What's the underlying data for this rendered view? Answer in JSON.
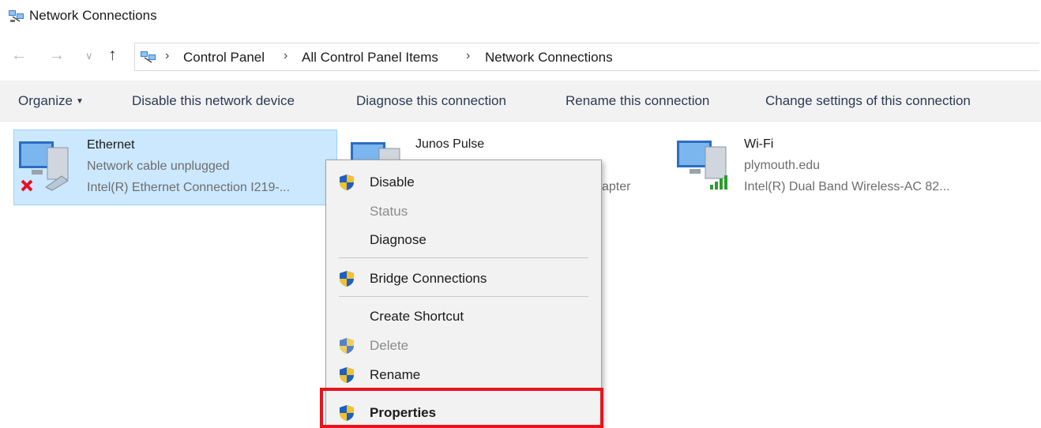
{
  "window": {
    "title": "Network Connections"
  },
  "address_bar": {
    "breadcrumbs": [
      "Control Panel",
      "All Control Panel Items",
      "Network Connections"
    ]
  },
  "command_bar": {
    "organize": "Organize",
    "disable": "Disable this network device",
    "diagnose": "Diagnose this connection",
    "rename": "Rename this connection",
    "change": "Change settings of this connection"
  },
  "adapters": [
    {
      "name": "Ethernet",
      "status": "Network cable unplugged",
      "device": "Intel(R) Ethernet Connection I219-...",
      "selected": true
    },
    {
      "name": "Junos Pulse",
      "status": "",
      "device": "apter",
      "selected": false
    },
    {
      "name": "Wi-Fi",
      "status": "plymouth.edu",
      "device": "Intel(R) Dual Band Wireless-AC 82...",
      "selected": false
    }
  ],
  "context_menu": {
    "items": [
      {
        "label": "Disable",
        "shield": true,
        "enabled": true
      },
      {
        "label": "Status",
        "shield": false,
        "enabled": false
      },
      {
        "label": "Diagnose",
        "shield": false,
        "enabled": true
      },
      {
        "label": "Bridge Connections",
        "shield": true,
        "enabled": true
      },
      {
        "label": "Create Shortcut",
        "shield": false,
        "enabled": true
      },
      {
        "label": "Delete",
        "shield": true,
        "enabled": false
      },
      {
        "label": "Rename",
        "shield": true,
        "enabled": true
      },
      {
        "label": "Properties",
        "shield": true,
        "enabled": true,
        "bold": true,
        "highlighted": true
      }
    ]
  },
  "colors": {
    "selection_bg": "#cce8ff",
    "highlight_border": "#e8141b",
    "command_bar_bg": "#f2f2f2"
  }
}
